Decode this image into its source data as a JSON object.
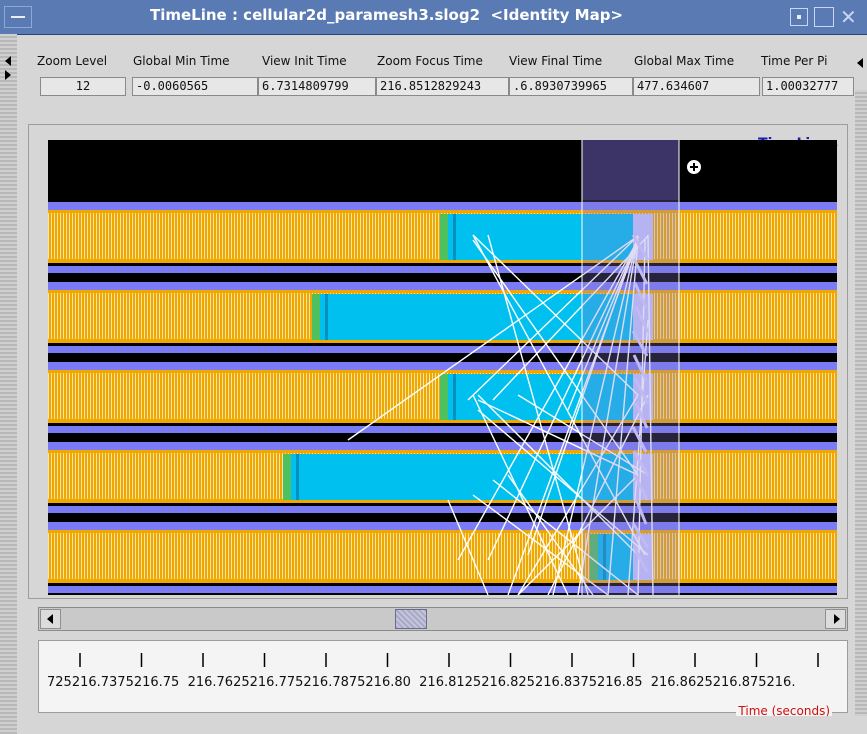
{
  "window": {
    "title": "TimeLine : cellular2d_paramesh3.slog2  <Identity Map>"
  },
  "info_table": {
    "headers": [
      "Zoom Level",
      "Global Min Time",
      "View  Init Time",
      "Zoom Focus Time",
      "View Final Time",
      "Global Max Time",
      "Time Per Pi"
    ],
    "values": [
      "12",
      "-0.0060565",
      "6.7314809799",
      "216.8512829243",
      ".6.8930739965",
      "477.634607",
      "1.00032777"
    ]
  },
  "panel": {
    "title": "TimeLines"
  },
  "axis": {
    "tick_text": "725216.7375216.75  216.7625216.775216.7875216.80  216.8125216.825216.8375216.85  216.8625216.875216.",
    "title": "Time (seconds)"
  },
  "colors": {
    "state_orange": "#f0a800",
    "state_stripe": "#f8e0a0",
    "state_cyan": "#00c0f0",
    "bar_periwinkle": "#7b7bf5",
    "arrow_white": "#ffffff",
    "selection": "#4a3f7a"
  },
  "icons": {
    "zoom_cursor": "magnifier-plus-icon"
  }
}
